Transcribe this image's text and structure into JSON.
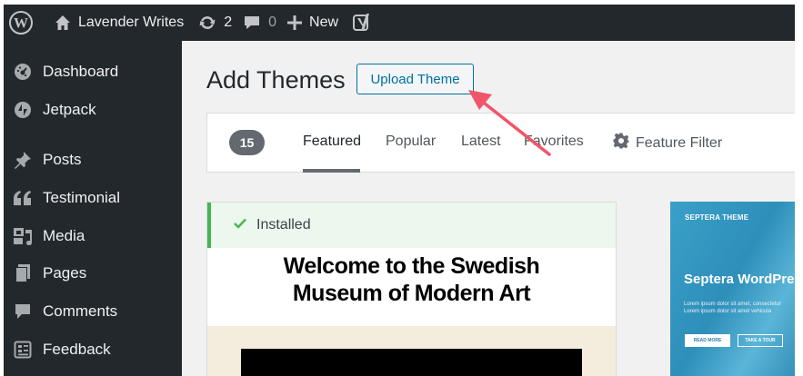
{
  "adminbar": {
    "site_name": "Lavender Writes",
    "updates_count": "2",
    "comments_count": "0",
    "new_label": "New"
  },
  "sidebar": {
    "items": [
      {
        "label": "Dashboard",
        "icon": "dashboard-icon"
      },
      {
        "label": "Jetpack",
        "icon": "jetpack-icon"
      },
      {
        "label": "Posts",
        "icon": "pushpin-icon"
      },
      {
        "label": "Testimonial",
        "icon": "quote-icon"
      },
      {
        "label": "Media",
        "icon": "media-icon"
      },
      {
        "label": "Pages",
        "icon": "pages-icon"
      },
      {
        "label": "Comments",
        "icon": "comment-icon"
      },
      {
        "label": "Feedback",
        "icon": "feedback-icon"
      }
    ]
  },
  "main": {
    "title": "Add Themes",
    "upload_label": "Upload Theme"
  },
  "filters": {
    "count": "15",
    "tabs": [
      "Featured",
      "Popular",
      "Latest",
      "Favorites"
    ],
    "active_tab": "Featured",
    "feature_filter": "Feature Filter"
  },
  "card1": {
    "installed": "Installed",
    "title_line1": "Welcome to the Swedish",
    "title_line2": "Museum of Modern Art"
  },
  "card2": {
    "brand": "SEPTERA THEME",
    "title": "Septera WordPre",
    "desc_line1": "Lorem ipsum dolor sit amet, consectetur",
    "desc_line2": "Lorem ipsum dolor sit amet vehicula",
    "btn_read": "READ MORE",
    "btn_tour": "TAKE A TOUR"
  },
  "colors": {
    "adminbar": "#23282d",
    "accent": "#0071a1",
    "annotation_arrow": "#f0566a",
    "installed_green": "#46b450"
  }
}
